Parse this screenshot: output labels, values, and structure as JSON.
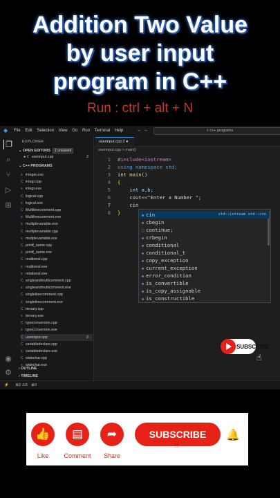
{
  "video_title": {
    "line1": "Addition Two Value",
    "line2": "by user input",
    "line3": "program in C++"
  },
  "subtitle": "Run : ctrl + alt + N",
  "titlebar": {
    "menu": [
      "File",
      "Edit",
      "Selection",
      "View",
      "Go",
      "Run",
      "Terminal",
      "Help"
    ],
    "search": "c++ programs"
  },
  "sidebar": {
    "header": "EXPLORER",
    "open_editors": {
      "label": "OPEN EDITORS",
      "badge": "1 unsaved",
      "file": "userinput.cpp",
      "count": "2"
    },
    "folder": "C++ PROGRAMS",
    "files": [
      "integer.exe",
      "integr.cpp",
      "integr.exe",
      "logical.cpp",
      "logical.exe",
      "Multilinecomment.cpp",
      "Multilinecomment.exe",
      "multiplevariable.exe",
      "multiplevariable.cpp",
      "mutiplevariable.exe",
      "printf_name.cpp",
      "printf_name.exe",
      "realtional.cpp",
      "realtional.exe",
      "relational.exe",
      "singleandmulticomment.cpp",
      "singleandmulticomment.exe",
      "singlelinecomment.cpp",
      "singlelinecomment.exe",
      "ternary.cpp",
      "ternary.exe",
      "typeconversion.cpp",
      "typeconversion.exe",
      "userinput.cpp",
      "variabledeclare.cpp",
      "variabledeclare.exe",
      "widechar.cpp",
      "widechar.exe"
    ],
    "userinput_count": "2",
    "outline": "OUTLINE",
    "timeline": "TIMELINE"
  },
  "tab": {
    "label": "userinput.cpp 2"
  },
  "breadcrumb": "userinput.cpp > main()",
  "code_lines": [
    {
      "n": "1",
      "text": "#include<iostream>"
    },
    {
      "n": "2",
      "text": "using namespace std;"
    },
    {
      "n": "3",
      "text": "int main()"
    },
    {
      "n": "4",
      "text": "{"
    },
    {
      "n": "5",
      "text": "    int a,b;"
    },
    {
      "n": "6",
      "text": "    cout<<\"Enter a Number \";"
    },
    {
      "n": "7",
      "text": "    cin"
    },
    {
      "n": "8",
      "text": "}"
    }
  ],
  "autocomplete": {
    "items": [
      "cin",
      "cbegin",
      "continue;",
      "crbegin",
      "conditional",
      "conditional_t",
      "copy_exception",
      "current_exception",
      "error_condition",
      "is_convertible",
      "is_copy_assignable",
      "is_constructible"
    ],
    "detail": "std::istream std::cin"
  },
  "statusbar": {
    "errors": "⊗2 ⚠0",
    "ports": "⊕0"
  },
  "subscribe_small": "SUBSCRIBE",
  "banner": {
    "like": "Like",
    "comment": "Comment",
    "share": "Share",
    "subscribe": "SUBSCRIBE"
  },
  "colors": {
    "accent_red": "#e62117",
    "vscode_blue": "#3c9bf0"
  }
}
